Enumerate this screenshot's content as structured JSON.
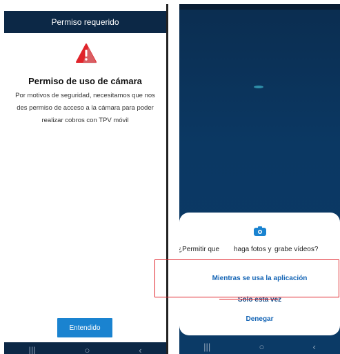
{
  "left_screen": {
    "header_title": "Permiso requerido",
    "permission_title": "Permiso de uso de cámara",
    "permission_description": "Por motivos de seguridad, necesitamos que nos des permiso de acceso a la cámara para poder realizar cobros con TPV móvil",
    "confirm_button": "Entendido",
    "nav": {
      "recent": "|||",
      "home": "○",
      "back": "‹"
    },
    "colors": {
      "header": "#0c2846",
      "button": "#1a83d0",
      "warning": "#e0242b"
    }
  },
  "right_screen": {
    "dialog": {
      "question_part1": "¿Permitir que",
      "question_part2": "haga fotos y",
      "question_part3": "grabe vídeos?",
      "option_while_using": "Mientras se usa la aplicación",
      "option_only_once": "Solo esta vez",
      "option_deny": "Denegar"
    },
    "nav": {
      "recent": "|||",
      "home": "○",
      "back": "‹"
    },
    "colors": {
      "background": "#0b3863",
      "accent": "#1565b5"
    }
  },
  "icons": [
    "warning-icon",
    "camera-icon"
  ]
}
